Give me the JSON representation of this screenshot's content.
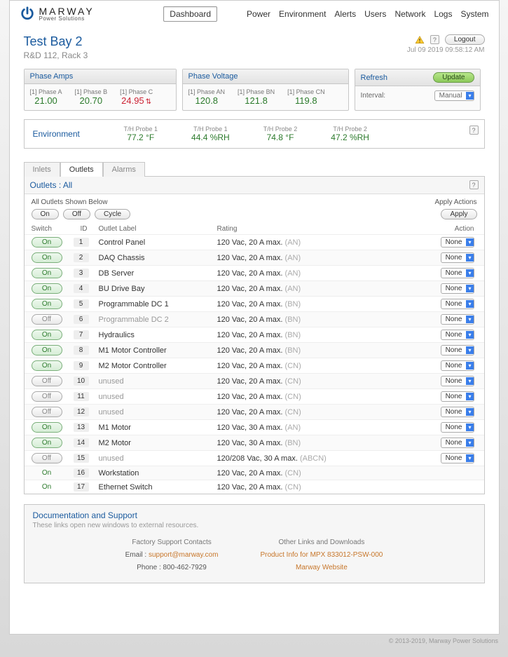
{
  "brand": {
    "name": "MARWAY",
    "sub": "Power Solutions"
  },
  "nav": {
    "items": [
      "Dashboard",
      "Power",
      "Environment",
      "Alerts",
      "Users",
      "Network",
      "Logs",
      "System"
    ],
    "active": "Dashboard"
  },
  "header": {
    "title": "Test Bay 2",
    "subtitle": "R&D 112, Rack 3",
    "logout": "Logout",
    "timestamp": "Jul 09 2019 09:58:12 AM"
  },
  "phase_amps": {
    "title": "Phase Amps",
    "items": [
      {
        "label": "[1] Phase A",
        "value": "21.00",
        "alert": false
      },
      {
        "label": "[1] Phase B",
        "value": "20.70",
        "alert": false
      },
      {
        "label": "[1] Phase C",
        "value": "24.95",
        "alert": true
      }
    ]
  },
  "phase_voltage": {
    "title": "Phase Voltage",
    "items": [
      {
        "label": "[1] Phase AN",
        "value": "120.8"
      },
      {
        "label": "[1] Phase BN",
        "value": "121.8"
      },
      {
        "label": "[1] Phase CN",
        "value": "119.8"
      }
    ]
  },
  "refresh": {
    "title": "Refresh",
    "update": "Update",
    "interval_label": "Interval:",
    "interval_value": "Manual"
  },
  "environment": {
    "title": "Environment",
    "items": [
      {
        "label": "T/H Probe 1",
        "value": "77.2 °F"
      },
      {
        "label": "T/H Probe 1",
        "value": "44.4 %RH"
      },
      {
        "label": "T/H Probe 2",
        "value": "74.8 °F"
      },
      {
        "label": "T/H Probe 2",
        "value": "47.2 %RH"
      }
    ]
  },
  "tabs": {
    "items": [
      "Inlets",
      "Outlets",
      "Alarms"
    ],
    "active": "Outlets"
  },
  "outlets": {
    "title": "Outlets : All",
    "batch": {
      "label": "All Outlets Shown Below",
      "on": "On",
      "off": "Off",
      "cycle": "Cycle",
      "apply_label": "Apply Actions",
      "apply": "Apply"
    },
    "columns": {
      "switch": "Switch",
      "id": "ID",
      "label": "Outlet Label",
      "rating": "Rating",
      "action": "Action"
    },
    "action_value": "None",
    "rows": [
      {
        "state": "on",
        "btn": true,
        "id": "1",
        "label": "Control Panel",
        "rating": "120 Vac, 20 A max.",
        "suffix": "(AN)"
      },
      {
        "state": "on",
        "btn": true,
        "id": "2",
        "label": "DAQ Chassis",
        "rating": "120 Vac, 20 A max.",
        "suffix": "(AN)"
      },
      {
        "state": "on",
        "btn": true,
        "id": "3",
        "label": "DB Server",
        "rating": "120 Vac, 20 A max.",
        "suffix": "(AN)"
      },
      {
        "state": "on",
        "btn": true,
        "id": "4",
        "label": "BU Drive Bay",
        "rating": "120 Vac, 20 A max.",
        "suffix": "(AN)"
      },
      {
        "state": "on",
        "btn": true,
        "id": "5",
        "label": "Programmable DC 1",
        "rating": "120 Vac, 20 A max.",
        "suffix": "(BN)"
      },
      {
        "state": "off",
        "btn": true,
        "id": "6",
        "label": "Programmable DC 2",
        "dim": true,
        "rating": "120 Vac, 20 A max.",
        "suffix": "(BN)"
      },
      {
        "state": "on",
        "btn": true,
        "id": "7",
        "label": "Hydraulics",
        "rating": "120 Vac, 20 A max.",
        "suffix": "(BN)"
      },
      {
        "state": "on",
        "btn": true,
        "id": "8",
        "label": "M1 Motor Controller",
        "rating": "120 Vac, 20 A max.",
        "suffix": "(BN)"
      },
      {
        "state": "on",
        "btn": true,
        "id": "9",
        "label": "M2 Motor Controller",
        "rating": "120 Vac, 20 A max.",
        "suffix": "(CN)"
      },
      {
        "state": "off",
        "btn": true,
        "id": "10",
        "label": "unused",
        "dim": true,
        "rating": "120 Vac, 20 A max.",
        "suffix": "(CN)"
      },
      {
        "state": "off",
        "btn": true,
        "id": "11",
        "label": "unused",
        "dim": true,
        "rating": "120 Vac, 20 A max.",
        "suffix": "(CN)"
      },
      {
        "state": "off",
        "btn": true,
        "id": "12",
        "label": "unused",
        "dim": true,
        "rating": "120 Vac, 20 A max.",
        "suffix": "(CN)"
      },
      {
        "state": "on",
        "btn": true,
        "id": "13",
        "label": "M1 Motor",
        "rating": "120 Vac, 30 A max.",
        "suffix": "(AN)"
      },
      {
        "state": "on",
        "btn": true,
        "id": "14",
        "label": "M2 Motor",
        "rating": "120 Vac, 30 A max.",
        "suffix": "(BN)"
      },
      {
        "state": "off",
        "btn": true,
        "id": "15",
        "label": "unused",
        "dim": true,
        "rating": "120/208 Vac, 30 A max.",
        "suffix": "(ABCN)"
      },
      {
        "state": "on",
        "btn": false,
        "id": "16",
        "label": "Workstation",
        "rating": "120 Vac, 20 A max.",
        "suffix": "(CN)",
        "no_action": true
      },
      {
        "state": "on",
        "btn": false,
        "id": "17",
        "label": "Ethernet Switch",
        "rating": "120 Vac, 20 A max.",
        "suffix": "(CN)",
        "no_action": true
      }
    ]
  },
  "docs": {
    "title": "Documentation and Support",
    "sub": "These links open new windows to external resources.",
    "left": {
      "hdr": "Factory Support Contacts",
      "email_label": "Email : ",
      "email": "support@marway.com",
      "phone_label": "Phone : ",
      "phone": "800-462-7929"
    },
    "right": {
      "hdr": "Other Links and Downloads",
      "link1": "Product Info for MPX 833012-PSW-000",
      "link2": "Marway Website"
    }
  },
  "copyright": "© 2013-2019, Marway Power Solutions"
}
